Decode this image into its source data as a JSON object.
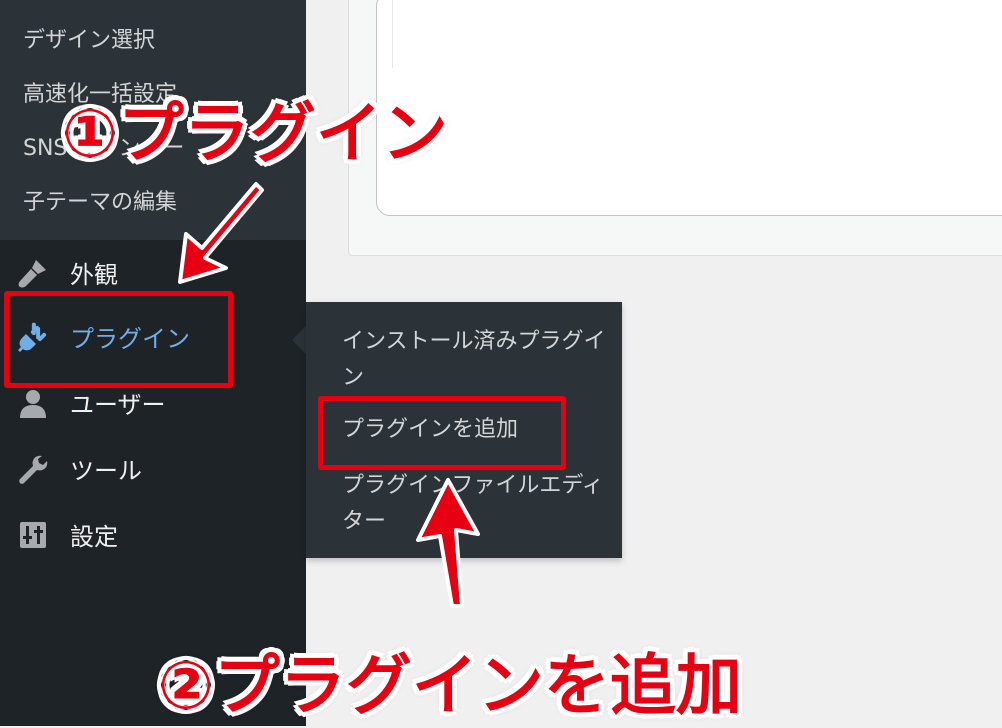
{
  "submenu": {
    "items": [
      {
        "label": "デザイン選択"
      },
      {
        "label": "高速化一括設定"
      },
      {
        "label": "SNS カウンター"
      },
      {
        "label": "子テーマの編集"
      }
    ]
  },
  "menu": {
    "items": [
      {
        "label": "外観",
        "icon": "paintbrush-icon"
      },
      {
        "label": "プラグイン",
        "icon": "plugin-icon",
        "active": true
      },
      {
        "label": "ユーザー",
        "icon": "user-icon"
      },
      {
        "label": "ツール",
        "icon": "wrench-icon"
      },
      {
        "label": "設定",
        "icon": "settings-icon"
      }
    ]
  },
  "flyout": {
    "items": [
      {
        "label": "インストール済みプラグイン"
      },
      {
        "label": "プラグインを追加"
      },
      {
        "label": "プラグインファイルエディター"
      }
    ]
  },
  "annotations": {
    "callout_1": "①プラグイン",
    "callout_2": "②プラグインを追加"
  },
  "colors": {
    "sidebar_bg": "#1d2327",
    "submenu_bg": "#2c3338",
    "active_text": "#72aee6",
    "annotation_red": "#e60012"
  }
}
